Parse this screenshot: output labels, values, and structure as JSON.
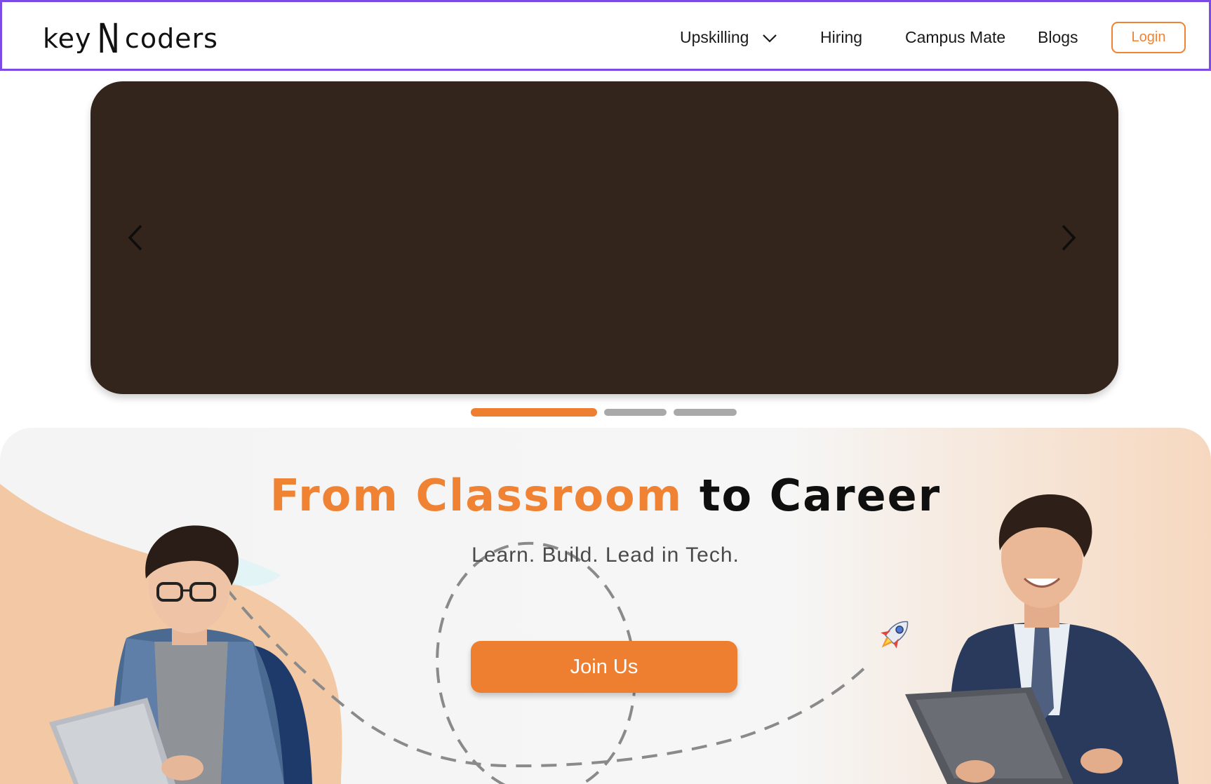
{
  "header": {
    "logo": {
      "left": "key",
      "mid": "N",
      "right": "coders"
    },
    "nav": {
      "upskilling": "Upskilling",
      "hiring": "Hiring",
      "campus_mate": "Campus Mate",
      "blogs": "Blogs"
    },
    "login_label": "Login"
  },
  "carousel": {
    "slide_count": 3,
    "active_index": 0,
    "prev_icon": "chevron-left-icon",
    "next_icon": "chevron-right-icon"
  },
  "hero": {
    "title_highlight": "From Classroom",
    "title_rest": "to Career",
    "subtitle": "Learn. Build. Lead in Tech.",
    "cta_label": "Join Us"
  },
  "colors": {
    "accent": "#ee7f30",
    "carousel_bg": "#33251b",
    "header_border": "#7b4be6"
  }
}
